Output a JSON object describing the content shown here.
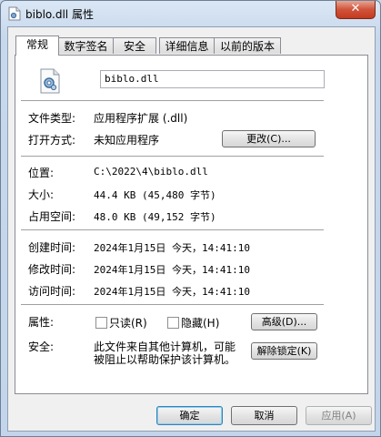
{
  "window": {
    "title": "biblo.dll 属性",
    "close": "✕"
  },
  "tabs": [
    "常规",
    "数字签名",
    "安全",
    "详细信息",
    "以前的版本"
  ],
  "general": {
    "filename": "biblo.dll",
    "file_type_label": "文件类型:",
    "file_type_value": "应用程序扩展 (.dll)",
    "open_with_label": "打开方式:",
    "open_with_value": "未知应用程序",
    "change_button": "更改(C)...",
    "location_label": "位置:",
    "location_value": "C:\\2022\\4\\biblo.dll",
    "size_label": "大小:",
    "size_value": "44.4 KB (45,480 字节)",
    "size_on_disk_label": "占用空间:",
    "size_on_disk_value": "48.0 KB (49,152 字节)",
    "created_label": "创建时间:",
    "created_value": "2024年1月15日 今天，14:41:10",
    "modified_label": "修改时间:",
    "modified_value": "2024年1月15日 今天，14:41:10",
    "accessed_label": "访问时间:",
    "accessed_value": "2024年1月15日 今天，14:41:10",
    "attributes_label": "属性:",
    "readonly_label": "只读(R)",
    "hidden_label": "隐藏(H)",
    "advanced_button": "高级(D)...",
    "security_label": "安全:",
    "security_text_line1": "此文件来自其他计算机，可能",
    "security_text_line2": "被阻止以帮助保护该计算机。",
    "unblock_button": "解除锁定(K)"
  },
  "footer": {
    "ok": "确定",
    "cancel": "取消",
    "apply": "应用(A)"
  }
}
